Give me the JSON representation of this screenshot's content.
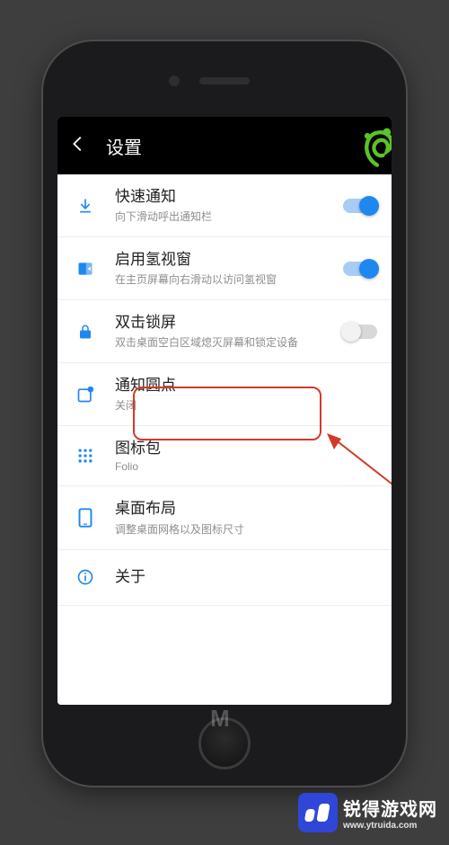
{
  "appbar": {
    "title": "设置"
  },
  "rows": [
    {
      "title": "快速通知",
      "sub": "向下滑动呼出通知栏",
      "toggle": "on"
    },
    {
      "title": "启用氢视窗",
      "sub": "在主页屏幕向右滑动以访问氢视窗",
      "toggle": "on"
    },
    {
      "title": "双击锁屏",
      "sub": "双击桌面空白区域熄灭屏幕和锁定设备",
      "toggle": "off"
    },
    {
      "title": "通知圆点",
      "sub": "关闭"
    },
    {
      "title": "图标包",
      "sub": "Folio"
    },
    {
      "title": "桌面布局",
      "sub": "调整桌面网格以及图标尺寸"
    },
    {
      "title": "关于"
    }
  ],
  "watermark": {
    "brand": "锐得游戏网",
    "domain": "www.ytruida.com",
    "center": "M"
  },
  "accent": "#1e88f0",
  "annotation_color": "#d23a2a"
}
